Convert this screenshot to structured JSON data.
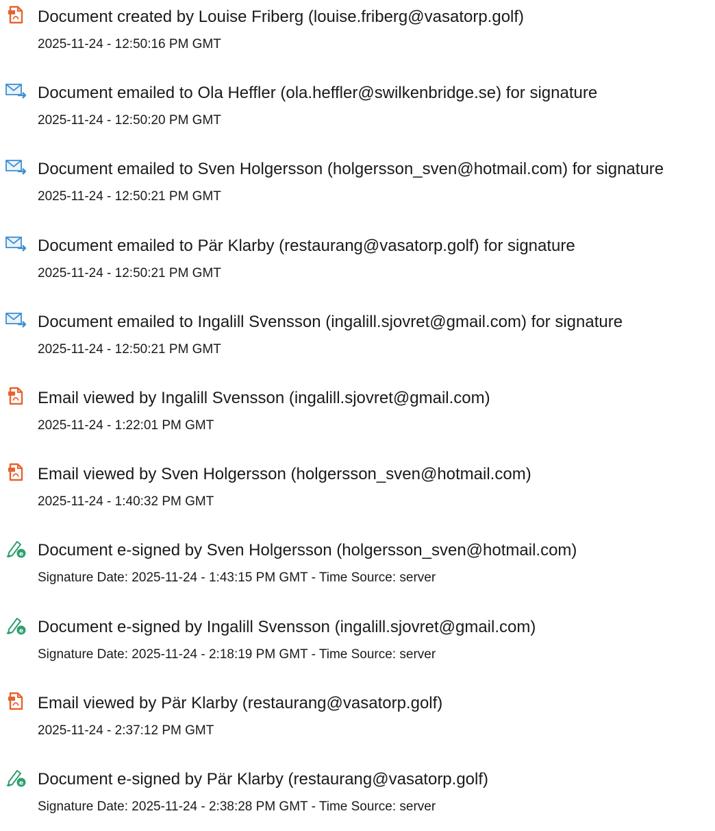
{
  "colors": {
    "pdf_icon": "#e8622e",
    "email_icon": "#3d8fd1",
    "sign_icon": "#2f9e6e",
    "text": "#1a1a1a"
  },
  "events": [
    {
      "icon": "pdf-document-icon",
      "title": "Document created by Louise Friberg (louise.friberg@vasatorp.golf)",
      "meta": "2025-11-24 - 12:50:16 PM GMT"
    },
    {
      "icon": "email-sent-icon",
      "title": "Document emailed to Ola Heffler (ola.heffler@swilkenbridge.se) for signature",
      "meta": "2025-11-24 - 12:50:20 PM GMT"
    },
    {
      "icon": "email-sent-icon",
      "title": "Document emailed to Sven Holgersson (holgersson_sven@hotmail.com) for signature",
      "meta": "2025-11-24 - 12:50:21 PM GMT"
    },
    {
      "icon": "email-sent-icon",
      "title": "Document emailed to Pär Klarby (restaurang@vasatorp.golf) for signature",
      "meta": "2025-11-24 - 12:50:21 PM GMT"
    },
    {
      "icon": "email-sent-icon",
      "title": "Document emailed to Ingalill Svensson (ingalill.sjovret@gmail.com) for signature",
      "meta": "2025-11-24 - 12:50:21 PM GMT"
    },
    {
      "icon": "pdf-document-icon",
      "title": "Email viewed by Ingalill Svensson (ingalill.sjovret@gmail.com)",
      "meta": "2025-11-24 - 1:22:01 PM GMT"
    },
    {
      "icon": "pdf-document-icon",
      "title": "Email viewed by Sven Holgersson (holgersson_sven@hotmail.com)",
      "meta": "2025-11-24 - 1:40:32 PM GMT"
    },
    {
      "icon": "e-sign-pen-icon",
      "title": "Document e-signed by Sven Holgersson (holgersson_sven@hotmail.com)",
      "meta": "Signature Date: 2025-11-24 - 1:43:15 PM GMT - Time Source: server"
    },
    {
      "icon": "e-sign-pen-icon",
      "title": "Document e-signed by Ingalill Svensson (ingalill.sjovret@gmail.com)",
      "meta": "Signature Date: 2025-11-24 - 2:18:19 PM GMT - Time Source: server"
    },
    {
      "icon": "pdf-document-icon",
      "title": "Email viewed by Pär Klarby (restaurang@vasatorp.golf)",
      "meta": "2025-11-24 - 2:37:12 PM GMT"
    },
    {
      "icon": "e-sign-pen-icon",
      "title": "Document e-signed by Pär Klarby (restaurang@vasatorp.golf)",
      "meta": "Signature Date: 2025-11-24 - 2:38:28 PM GMT - Time Source: server"
    }
  ]
}
